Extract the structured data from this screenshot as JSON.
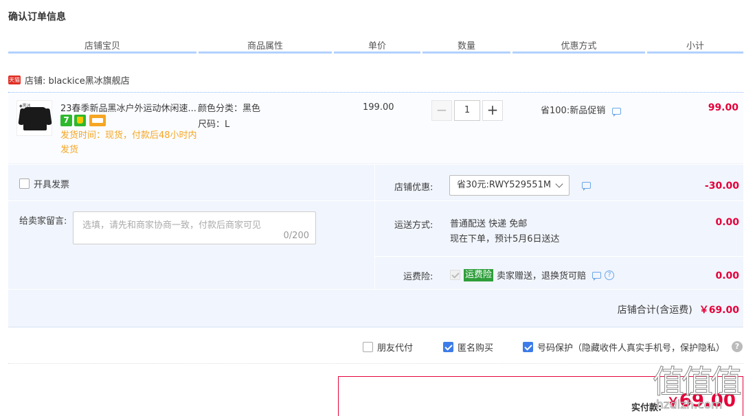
{
  "page_title": "确认订单信息",
  "columns": [
    "店铺宝贝",
    "商品属性",
    "单价",
    "数量",
    "优惠方式",
    "小计"
  ],
  "shop": {
    "badge": "天猫",
    "label": "店铺: blackice黑冰旗舰店"
  },
  "item": {
    "thumb_logo": "◆黑冰",
    "name": "23春季新品黑冰户外运动休闲速...",
    "badge_7": "7",
    "ship_time": "发货时间：现货，付款后48小时内发货",
    "attr_color": "颜色分类：黑色",
    "attr_size": "尺码：L",
    "price": "199.00",
    "qty_minus": "−",
    "qty": "1",
    "qty_plus": "+",
    "promo": "省100:新品促销",
    "subtotal": "99.00"
  },
  "options": {
    "invoice_label": "开具发票",
    "message_label": "给卖家留言:",
    "message_placeholder": "选填，请先和商家协商一致，付款后商家可见",
    "message_count": "0/200",
    "coupon_label": "店铺优惠:",
    "coupon_value": "省30元:RWY529551M",
    "coupon_amount": "-30.00",
    "shipping_label": "运送方式:",
    "shipping_line1": "普通配送 快递 免邮",
    "shipping_line2": "现在下单，预计5月6日送达",
    "shipping_amount": "0.00",
    "insurance_label": "运费险:",
    "insurance_tag": "运费险",
    "insurance_text": "卖家赠送，退换货可赔",
    "insurance_q": "?",
    "insurance_amount": "0.00",
    "shop_total_label": "店铺合计(含运费)",
    "shop_total_amount": "￥69.00"
  },
  "bottom": {
    "friend_pay": "朋友代付",
    "anonymous": "匿名购买",
    "phone_protect": "号码保护（隐藏收件人真实手机号，保护隐私）",
    "help": "?"
  },
  "payment": {
    "label": "实付款:",
    "currency": "￥",
    "amount": "69.00"
  },
  "watermark": {
    "text": "值值值",
    "url": "hzdlzh.com"
  },
  "colors": {
    "accent_red": "#e4003a",
    "header_line": "#b2d1ff",
    "panel_bg": "#f1f5fd",
    "check_blue": "#3d7be8",
    "ship_orange": "#f5a623"
  }
}
